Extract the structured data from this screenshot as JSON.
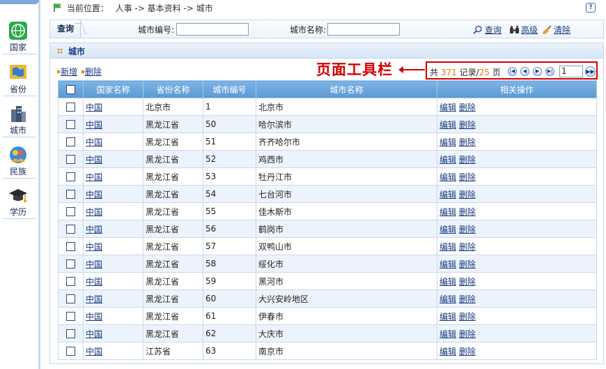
{
  "sidebar": {
    "items": [
      {
        "label": "国家",
        "icon": "globe-icon"
      },
      {
        "label": "省份",
        "icon": "map-icon"
      },
      {
        "label": "城市",
        "icon": "buildings-icon"
      },
      {
        "label": "民族",
        "icon": "people-icon"
      },
      {
        "label": "学历",
        "icon": "graduation-cap-icon"
      }
    ]
  },
  "breadcrumb": {
    "prefix": "当前位置：",
    "path": "人事  -> 基本资料  -> 城市"
  },
  "help": {
    "label": "?"
  },
  "search": {
    "tab": "查询",
    "code_label": "城市编号:",
    "code_value": "",
    "name_label": "城市名称:",
    "name_value": "",
    "query": "查询",
    "advanced": "高级",
    "clear": "清除"
  },
  "panel": {
    "title": "城市"
  },
  "toolbar": {
    "add": "新增",
    "delete": "删除"
  },
  "annotation": "页面工具栏",
  "pager": {
    "prefix": "共",
    "total": "371",
    "records": "记录/",
    "pages": "25",
    "page_suffix": "页",
    "current": "1"
  },
  "table": {
    "columns": [
      "国家名称",
      "省份名称",
      "城市编号",
      "城市名称",
      "相关操作"
    ],
    "edit": "编辑",
    "del": "删除",
    "rows": [
      {
        "country": "中国",
        "province": "北京市",
        "code": "1",
        "city": "北京市"
      },
      {
        "country": "中国",
        "province": "黑龙江省",
        "code": "50",
        "city": "哈尔滨市"
      },
      {
        "country": "中国",
        "province": "黑龙江省",
        "code": "51",
        "city": "齐齐哈尔市"
      },
      {
        "country": "中国",
        "province": "黑龙江省",
        "code": "52",
        "city": "鸡西市"
      },
      {
        "country": "中国",
        "province": "黑龙江省",
        "code": "53",
        "city": "牡丹江市"
      },
      {
        "country": "中国",
        "province": "黑龙江省",
        "code": "54",
        "city": "七台河市"
      },
      {
        "country": "中国",
        "province": "黑龙江省",
        "code": "55",
        "city": "佳木斯市"
      },
      {
        "country": "中国",
        "province": "黑龙江省",
        "code": "56",
        "city": "鹤岗市"
      },
      {
        "country": "中国",
        "province": "黑龙江省",
        "code": "57",
        "city": "双鸭山市"
      },
      {
        "country": "中国",
        "province": "黑龙江省",
        "code": "58",
        "city": "绥化市"
      },
      {
        "country": "中国",
        "province": "黑龙江省",
        "code": "59",
        "city": "黑河市"
      },
      {
        "country": "中国",
        "province": "黑龙江省",
        "code": "60",
        "city": "大兴安岭地区"
      },
      {
        "country": "中国",
        "province": "黑龙江省",
        "code": "61",
        "city": "伊春市"
      },
      {
        "country": "中国",
        "province": "黑龙江省",
        "code": "62",
        "city": "大庆市"
      },
      {
        "country": "中国",
        "province": "江苏省",
        "code": "63",
        "city": "南京市"
      }
    ]
  },
  "colors": {
    "accent": "#5c98d3",
    "annotation": "#d40000",
    "link": "#1a3a80"
  }
}
